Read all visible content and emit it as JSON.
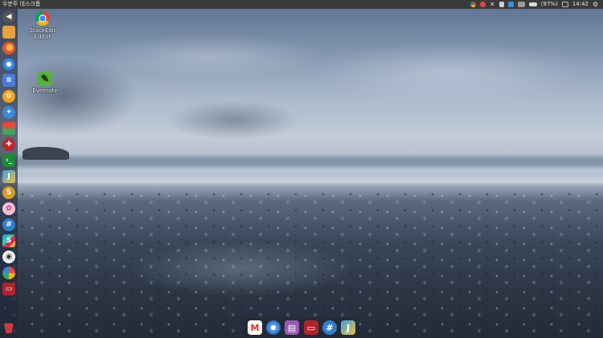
{
  "top_panel": {
    "title": "우분투 데스크톱",
    "battery": "(97%)",
    "clock": "14:42",
    "indicators": [
      "chrome-icon",
      "red-circle-icon",
      "x-icon",
      "network-icon",
      "dropbox-icon",
      "keyboard-icon",
      "battery-icon"
    ]
  },
  "desktop": {
    "icons": [
      {
        "label": "StackEdit\nEditor",
        "icon": "chrome-icon"
      },
      {
        "label": "Evernote",
        "icon": "evernote-icon"
      }
    ]
  },
  "launcher": {
    "items": [
      "back-icon",
      "files-icon",
      "firefox-icon",
      "chromium-icon",
      "docs-icon",
      "settings-icon",
      "browser-icon",
      "software-center-icon",
      "red-app-icon",
      "terminal-icon",
      "jetbrains-icon",
      "s-app-icon",
      "pinwheel-icon",
      "hash-icon",
      "slack-icon",
      "circle-app-icon",
      "color-wheel-icon",
      "screen-app-icon",
      "trash-icon"
    ]
  },
  "dock": {
    "items": [
      "gmail-icon",
      "chromium-icon",
      "document-icon",
      "screen-app-icon",
      "hash-icon",
      "jetbrains-icon"
    ]
  },
  "colors": {
    "panel": "#3a3a3a",
    "launcher": "#1e283c",
    "accent_blue": "#3d8be0"
  }
}
